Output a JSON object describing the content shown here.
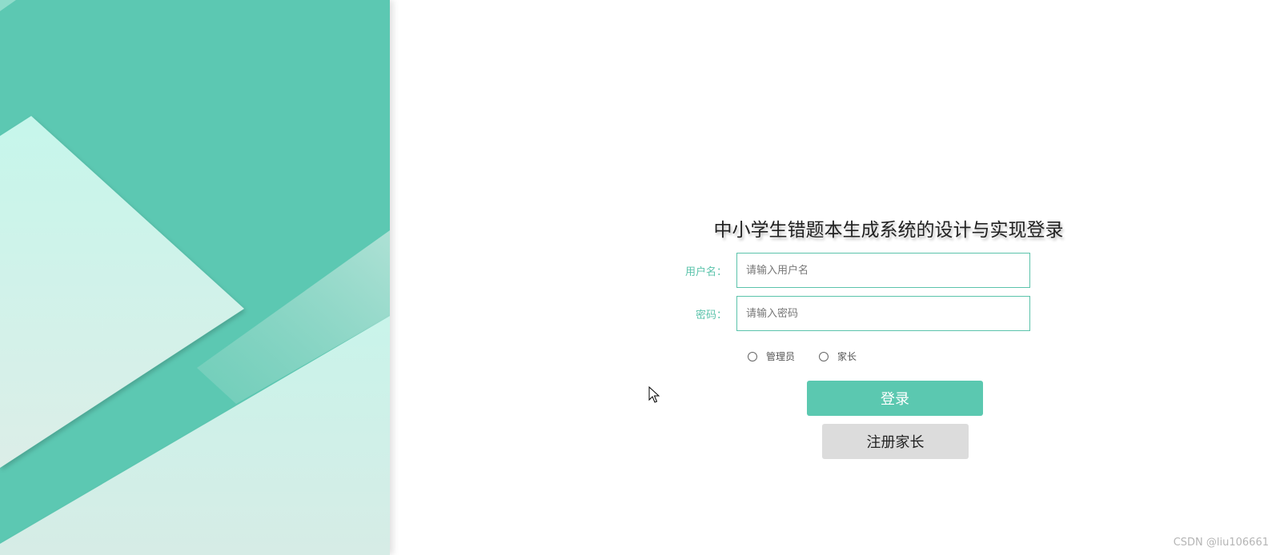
{
  "login": {
    "title": "中小学生错题本生成系统的设计与实现登录",
    "username_label": "用户名：",
    "username_placeholder": "请输入用户名",
    "password_label": "密码：",
    "password_placeholder": "请输入密码",
    "roles": [
      "管理员",
      "家长"
    ],
    "login_button": "登录",
    "register_button": "注册家长"
  },
  "watermark": "CSDN @liu106661",
  "colors": {
    "accent": "#5bc8b0",
    "label": "#5bc3ab",
    "panel_light": "#c8f5ea",
    "register_bg": "#dcdcdc"
  }
}
